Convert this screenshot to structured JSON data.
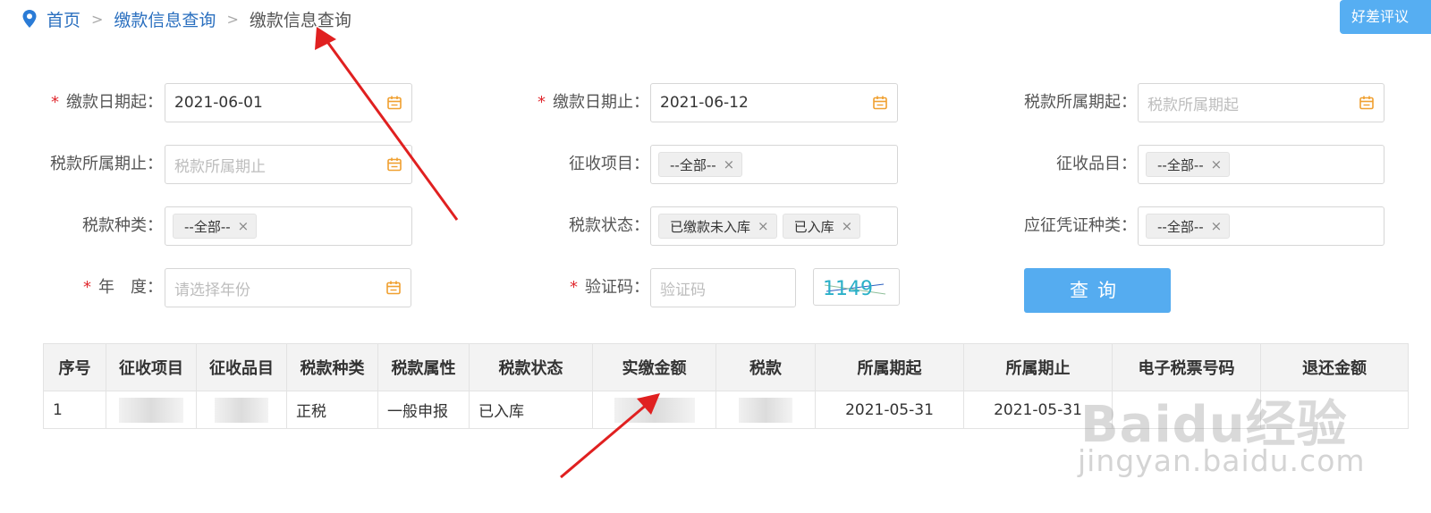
{
  "breadcrumb": {
    "home": "首页",
    "parent": "缴款信息查询",
    "current": "缴款信息查询",
    "separator": ">"
  },
  "rate_button": "好差评议",
  "form": {
    "pay_date_start": {
      "label": "缴款日期起：",
      "value": "2021-06-01"
    },
    "pay_date_end": {
      "label": "缴款日期止：",
      "value": "2021-06-12"
    },
    "tax_period_start": {
      "label": "税款所属期起：",
      "placeholder": "税款所属期起"
    },
    "tax_period_end": {
      "label": "税款所属期止：",
      "placeholder": "税款所属期止"
    },
    "levy_item": {
      "label": "征收项目：",
      "tags": [
        "--全部--"
      ]
    },
    "levy_subitem": {
      "label": "征收品目：",
      "tags": [
        "--全部--"
      ]
    },
    "tax_type": {
      "label": "税款种类：",
      "tags": [
        "--全部--"
      ]
    },
    "tax_status": {
      "label": "税款状态：",
      "tags": [
        "已缴款未入库",
        "已入库"
      ]
    },
    "voucher_type": {
      "label": "应征凭证种类：",
      "tags": [
        "--全部--"
      ]
    },
    "year": {
      "label": "年　度：",
      "placeholder": "请选择年份"
    },
    "captcha": {
      "label": "验证码：",
      "placeholder": "验证码",
      "image_text": "1149"
    },
    "required_mark": "*",
    "tag_remove": "×",
    "query_button": "查询"
  },
  "table": {
    "headers": [
      "序号",
      "征收项目",
      "征收品目",
      "税款种类",
      "税款属性",
      "税款状态",
      "实缴金额",
      "税款",
      "所属期起",
      "所属期止",
      "电子税票号码",
      "退还金额"
    ],
    "rows": [
      {
        "index": "1",
        "tax_type": "正税",
        "tax_attr": "一般申报",
        "status": "已入库",
        "period_start": "2021-05-31",
        "period_end": "2021-05-31"
      }
    ]
  },
  "watermark": {
    "logo": "Baidu经验",
    "url": "jingyan.baidu.com"
  },
  "colors": {
    "accent": "#55acf0",
    "link": "#2a6fbf",
    "required": "#e0282e",
    "arrow": "#e02020",
    "calendar_icon": "#f0a030"
  }
}
